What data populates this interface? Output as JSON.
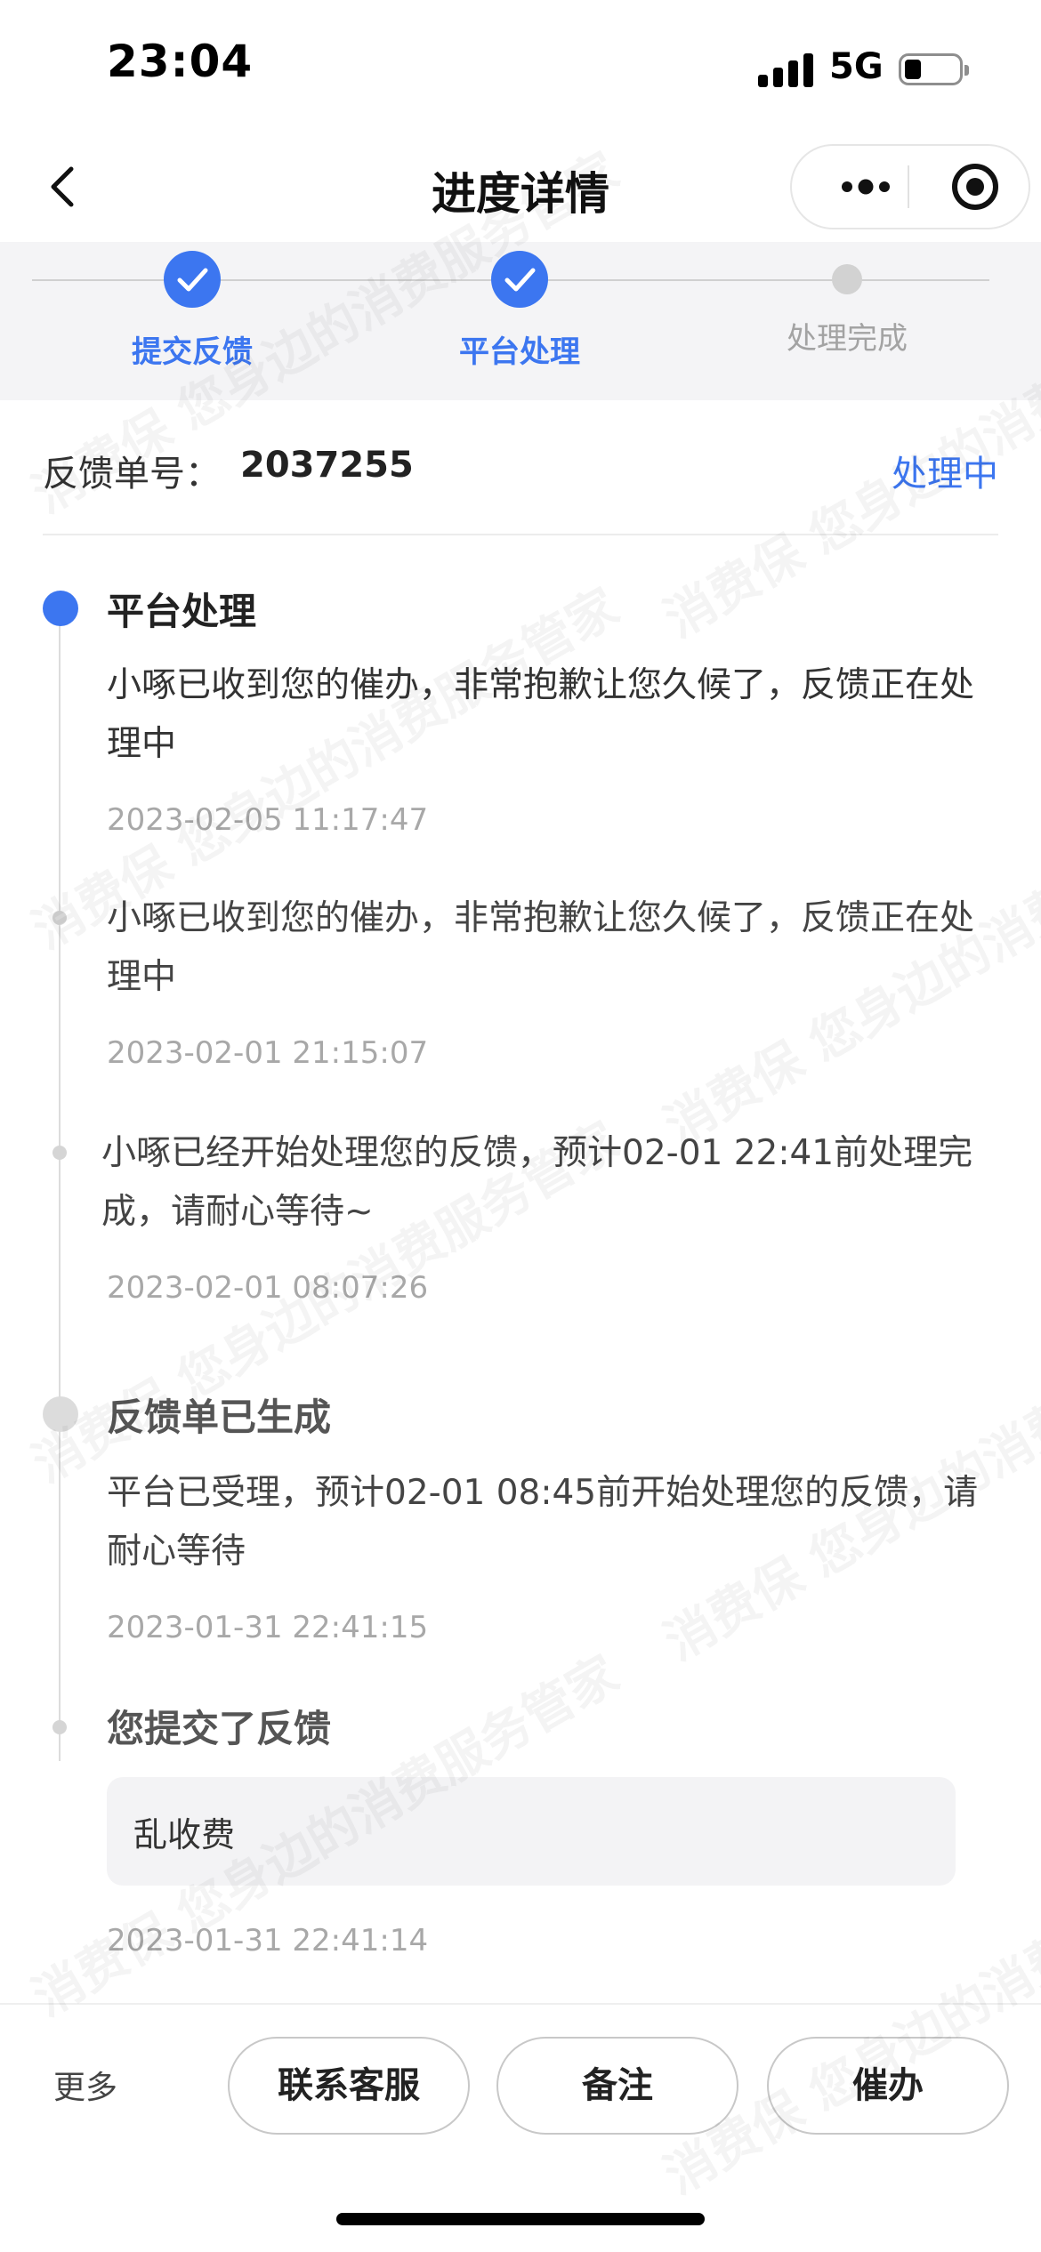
{
  "status_bar": {
    "time": "23:04",
    "network": "5G",
    "icons": [
      "signal-icon",
      "battery-icon"
    ]
  },
  "nav": {
    "title": "进度详情",
    "icons": [
      "back-icon",
      "more-icon",
      "target-icon"
    ]
  },
  "stepper": {
    "steps": [
      {
        "label": "提交反馈",
        "state": "done"
      },
      {
        "label": "平台处理",
        "state": "done"
      },
      {
        "label": "处理完成",
        "state": "pending"
      }
    ],
    "colors": {
      "done": "#3c76f0",
      "pending": "#a3a3a3"
    }
  },
  "order": {
    "label": "反馈单号：",
    "number": "2037255",
    "status": "处理中"
  },
  "timeline": {
    "entries": [
      {
        "title": "平台处理",
        "content": "小啄已收到您的催办，非常抱歉让您久候了，反馈正在处理中",
        "time": "2023-02-05 11:17:47"
      },
      {
        "content": "小啄已收到您的催办，非常抱歉让您久候了，反馈正在处理中",
        "time": "2023-02-01 21:15:07"
      },
      {
        "content": "小啄已经开始处理您的反馈，预计02-01 22:41前处理完成，请耐心等待~",
        "time": "2023-02-01 08:07:26"
      },
      {
        "title": "反馈单已生成",
        "content": "平台已受理，预计02-01 08:45前开始处理您的反馈，请耐心等待",
        "time": "2023-01-31 22:41:15"
      },
      {
        "title": "您提交了反馈",
        "reason": "乱收费",
        "time": "2023-01-31 22:41:14"
      }
    ]
  },
  "bottom_bar": {
    "more": "更多",
    "buttons": [
      "联系客服",
      "备注",
      "催办"
    ]
  },
  "watermark": {
    "lines": [
      "消费保 您身边的消费服务管家",
      "消费保 您身边的消费服务管家",
      "消费保 您身边的消费服务管家",
      "消费保 您身边的消费服务管家",
      "消费保 您身边的消费服务管家",
      "消费保 您身边的消费服务管家",
      "消费保 您身边的消费服务管家",
      "消费保 您身边的消费服务管家"
    ]
  },
  "accent_color": "#3c76f0"
}
